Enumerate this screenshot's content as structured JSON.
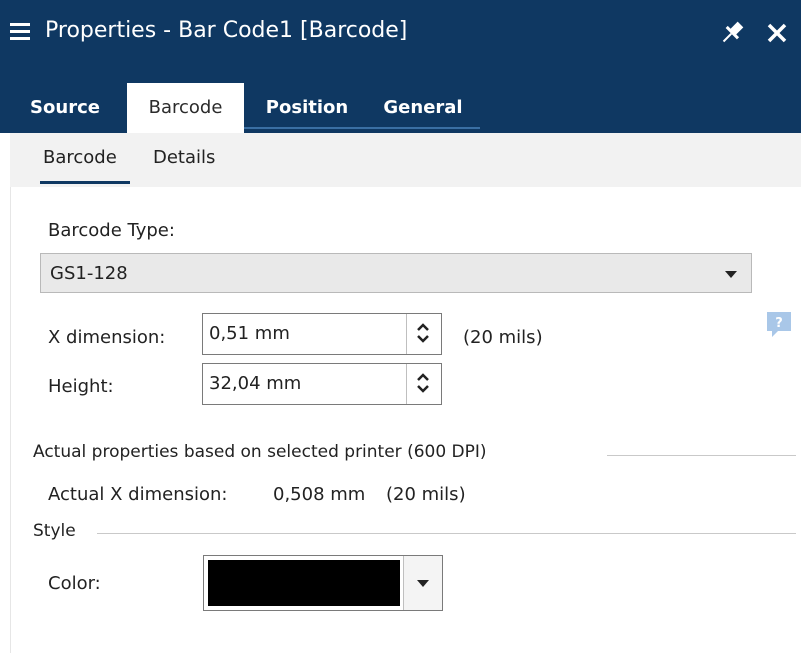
{
  "title_bar": {
    "title": "Properties - Bar Code1 [Barcode]",
    "menu_icon": "hamburger-icon",
    "pin_icon": "pin-icon",
    "close_icon": "close-icon"
  },
  "tabs": [
    {
      "label": "Source",
      "active": false
    },
    {
      "label": "Barcode",
      "active": true
    },
    {
      "label": "Position",
      "active": false
    },
    {
      "label": "General",
      "active": false
    }
  ],
  "subtabs": [
    {
      "label": "Barcode",
      "active": true
    },
    {
      "label": "Details",
      "active": false
    }
  ],
  "barcode": {
    "type_label": "Barcode Type:",
    "type_value": "GS1-128",
    "x_dimension_label": "X dimension:",
    "x_dimension_value": "0,51 mm",
    "x_dimension_mils": "(20 mils)",
    "height_label": "Height:",
    "height_value": "32,04 mm"
  },
  "actual": {
    "group_title": "Actual properties based on selected printer (600 DPI)",
    "x_dimension_label": "Actual X dimension:",
    "x_dimension_value": "0,508 mm",
    "x_dimension_mils": "(20 mils)"
  },
  "style": {
    "group_title": "Style",
    "color_label": "Color:",
    "color_value": "#000000"
  },
  "colors": {
    "header_bg": "#0f3862",
    "subtab_bg": "#f2f2f2",
    "help_icon": "#a9c7e8"
  }
}
